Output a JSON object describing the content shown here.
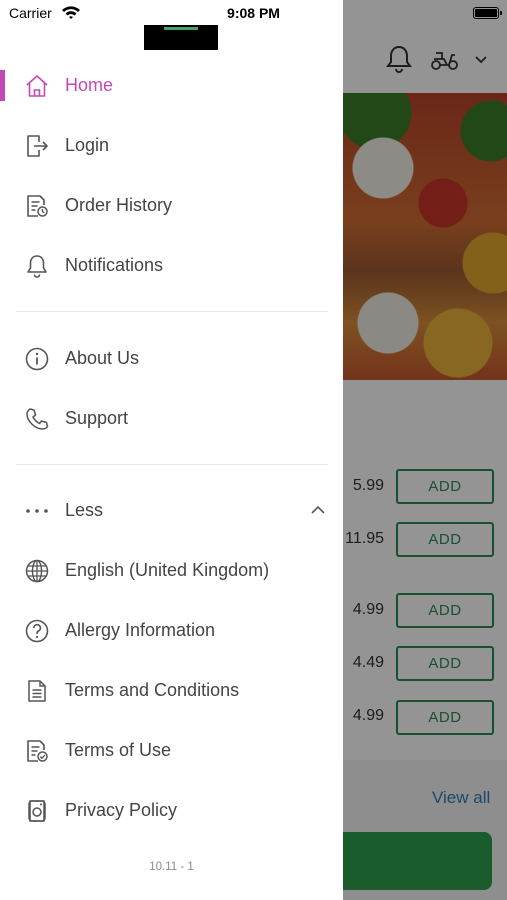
{
  "status_bar": {
    "carrier": "Carrier",
    "time": "9:08 PM"
  },
  "menu": {
    "items": [
      {
        "label": "Home",
        "icon": "home-icon",
        "active": true
      },
      {
        "label": "Login",
        "icon": "login-icon"
      },
      {
        "label": "Order History",
        "icon": "order-history-icon"
      },
      {
        "label": "Notifications",
        "icon": "bell-icon"
      },
      {
        "label": "About Us",
        "icon": "info-icon"
      },
      {
        "label": "Support",
        "icon": "phone-icon"
      },
      {
        "label": "Less",
        "icon": "more-dots-icon"
      },
      {
        "label": "English (United Kingdom)",
        "icon": "globe-icon"
      },
      {
        "label": "Allergy Information",
        "icon": "question-icon"
      },
      {
        "label": "Terms and Conditions",
        "icon": "document-icon"
      },
      {
        "label": "Terms of Use",
        "icon": "document-check-icon"
      },
      {
        "label": "Privacy Policy",
        "icon": "privacy-icon"
      }
    ],
    "version": "10.11 - 1"
  },
  "background": {
    "products": [
      {
        "price": "5.99",
        "button": "ADD"
      },
      {
        "price": "11.95",
        "button": "ADD"
      },
      {
        "price": "4.99",
        "button": "ADD"
      },
      {
        "price": "4.49",
        "button": "ADD"
      },
      {
        "price": "4.99",
        "button": "ADD"
      }
    ],
    "view_all": "View all"
  },
  "colors": {
    "accent": "#c24ab8",
    "add_button": "#2e8b57",
    "link": "#2f7fb5"
  }
}
